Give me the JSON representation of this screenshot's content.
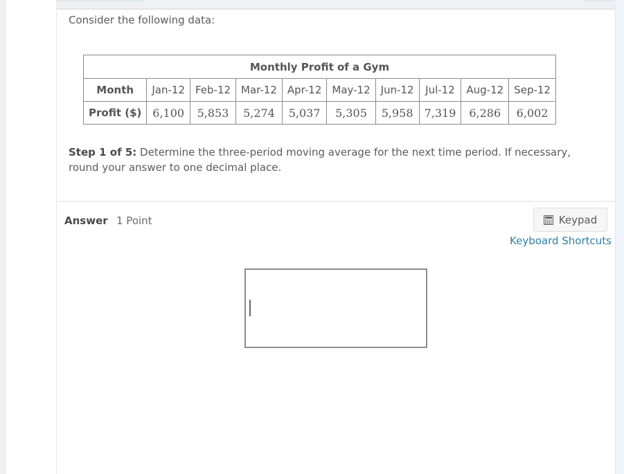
{
  "intro_text": "Consider the following data:",
  "table": {
    "caption": "Monthly Profit of a Gym",
    "row_headers": [
      "Month",
      "Profit ($)"
    ],
    "months": [
      "Jan-12",
      "Feb-12",
      "Mar-12",
      "Apr-12",
      "May-12",
      "Jun-12",
      "Jul-12",
      "Aug-12",
      "Sep-12"
    ],
    "profits": [
      "6,100",
      "5,853",
      "5,274",
      "5,037",
      "5,305",
      "5,958",
      "7,319",
      "6,286",
      "6,002"
    ]
  },
  "step": {
    "label": "Step 1 of 5:",
    "text": " Determine the three-period moving average for the next time period. If necessary, round your answer to one decimal place."
  },
  "answer": {
    "label": "Answer",
    "points": "1 Point",
    "value": ""
  },
  "keypad": {
    "icon": "calculator-icon",
    "label": "Keypad"
  },
  "shortcuts_link": "Keyboard Shortcuts"
}
